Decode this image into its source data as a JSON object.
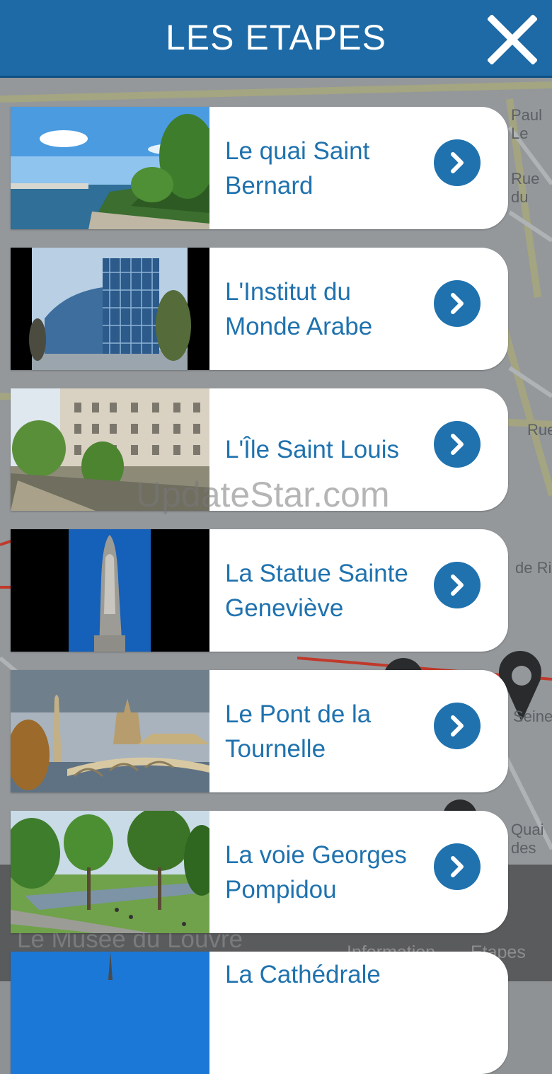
{
  "header": {
    "title": "LES ETAPES"
  },
  "steps": [
    {
      "title": "Le quai Saint Bernard"
    },
    {
      "title": "L'Institut du Monde Arabe"
    },
    {
      "title": "L'Île Saint Louis"
    },
    {
      "title": "La Statue Sainte Geneviève"
    },
    {
      "title": "Le Pont de la Tournelle"
    },
    {
      "title": "La voie Georges Pompidou"
    },
    {
      "title": "La Cathédrale"
    }
  ],
  "background": {
    "behind_text": "Le Musée du Louvre",
    "tabs": [
      "Information",
      "Etapes"
    ],
    "map_labels": [
      "Paul Le",
      "Rue du",
      "Rue d",
      "Rue",
      "Quai des",
      "Seine",
      "de Ri"
    ]
  },
  "watermark": "UpdateStar.com",
  "colors": {
    "header": "#1d6aa6",
    "accent": "#1f72ae",
    "card": "#ffffff"
  }
}
